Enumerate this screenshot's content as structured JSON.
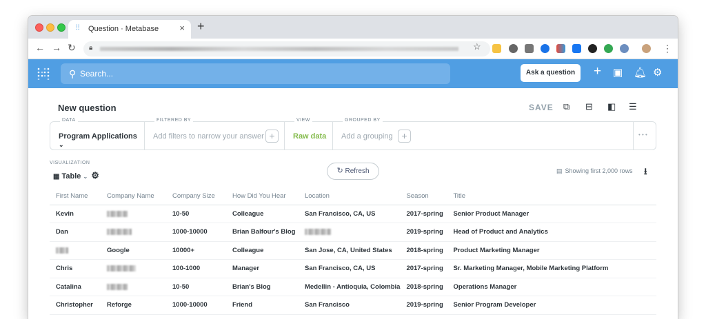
{
  "browser": {
    "tab_title": "Question · Metabase",
    "tab_close": "×",
    "new_tab": "+"
  },
  "metabase_nav": {
    "search_placeholder": "Search...",
    "ask_question": "Ask a question"
  },
  "question": {
    "title": "New question",
    "save": "SAVE"
  },
  "query_builder": {
    "data_label": "DATA",
    "data_value": "Program Applications",
    "filter_label": "FILTERED BY",
    "filter_placeholder": "Add filters to narrow your answer",
    "view_label": "VIEW",
    "view_value": "Raw data",
    "group_label": "GROUPED BY",
    "group_placeholder": "Add a grouping",
    "more": "• • •"
  },
  "visualization": {
    "label": "VISUALIZATION",
    "selected": "Table",
    "refresh": "Refresh",
    "rows_info": "Showing first 2,000 rows"
  },
  "table": {
    "columns": [
      "First Name",
      "Company Name",
      "Company Size",
      "How Did You Hear",
      "Location",
      "Season",
      "Title"
    ],
    "rows": [
      [
        "Kevin",
        "",
        "10-50",
        "Colleague",
        "San Francisco, CA, US",
        "2017-spring",
        "Senior Product Manager"
      ],
      [
        "Dan",
        "",
        "1000-10000",
        "Brian Balfour's Blog",
        "",
        "2019-spring",
        "Head of Product and Analytics"
      ],
      [
        "",
        "Google",
        "10000+",
        "Colleague",
        "San Jose, CA, United States",
        "2018-spring",
        "Product Marketing Manager"
      ],
      [
        "Chris",
        "",
        "100-1000",
        "Manager",
        "San Francisco, CA, US",
        "2017-spring",
        "Sr. Marketing Manager, Mobile Marketing Platform"
      ],
      [
        "Catalina",
        "",
        "10-50",
        "Brian's Blog",
        "Medellin - Antioquia, Colombia",
        "2018-spring",
        "Operations Manager"
      ],
      [
        "Christopher",
        "Reforge",
        "1000-10000",
        "Friend",
        "San Francisco",
        "2019-spring",
        "Senior Program Developer"
      ]
    ]
  },
  "colors": {
    "brand": "#509ee3",
    "view_green": "#84bb4c"
  }
}
